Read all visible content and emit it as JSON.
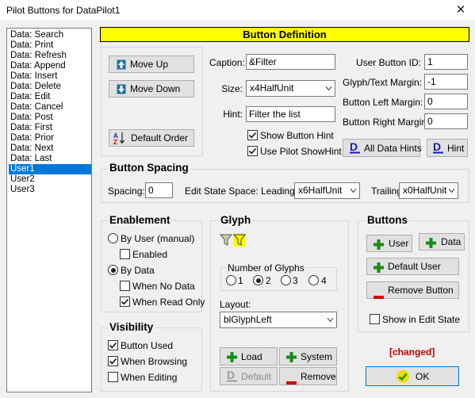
{
  "window": {
    "title": "Pilot Buttons for DataPilot1",
    "close": "✕"
  },
  "buttons_list": {
    "items": [
      "Data: Search",
      "Data: Print",
      "Data: Refresh",
      "Data: Append",
      "Data: Insert",
      "Data: Delete",
      "Data: Edit",
      "Data: Cancel",
      "Data: Post",
      "Data: First",
      "Data: Prior",
      "Data: Next",
      "Data: Last",
      "User1",
      "User2",
      "User3"
    ],
    "selected": "User1"
  },
  "definition": {
    "header": "Button Definition",
    "move_up": "Move Up",
    "move_down": "Move Down",
    "default_order": "Default Order",
    "caption_label": "Caption:",
    "caption_value": "&Filter",
    "size_label": "Size:",
    "size_value": "x4HalfUnit",
    "hint_label": "Hint:",
    "hint_value": "Filter the list",
    "show_button_hint": "Show Button Hint",
    "use_pilot_showhint": "Use Pilot ShowHint",
    "user_button_id_label": "User Button ID:",
    "user_button_id_value": "1",
    "glyph_text_margin_label": "Glyph/Text Margin:",
    "glyph_text_margin_value": "-1",
    "button_left_margin_label": "Button Left Margin:",
    "button_left_margin_value": "0",
    "button_right_margin_label": "Button Right Margin:",
    "button_right_margin_value": "0",
    "all_data_hints": "All Data Hints",
    "hint_button": "Hint"
  },
  "spacing": {
    "title": "Button Spacing",
    "spacing_label": "Spacing:",
    "spacing_value": "0",
    "leading_label": "Edit State Space: Leading =",
    "leading_value": "x6HalfUnit",
    "trailing_label": "Trailing =",
    "trailing_value": "x0HalfUnit"
  },
  "enablement": {
    "title": "Enablement",
    "by_user": "By User (manual)",
    "enabled": "Enabled",
    "by_data": "By Data",
    "when_no_data": "When No Data",
    "when_read_only": "When Read Only"
  },
  "visibility": {
    "title": "Visibility",
    "button_used": "Button Used",
    "when_browsing": "When Browsing",
    "when_editing": "When Editing"
  },
  "glyph": {
    "title": "Glyph",
    "number_of_glyphs": "Number of Glyphs",
    "options": [
      "1",
      "2",
      "3",
      "4"
    ],
    "selected": "2",
    "layout_label": "Layout:",
    "layout_value": "blGlyphLeft",
    "load": "Load",
    "system": "System",
    "default": "Default",
    "remove": "Remove"
  },
  "buttons_group": {
    "title": "Buttons",
    "user": "User",
    "data": "Data",
    "default_user": "Default User",
    "remove_button": "Remove Button",
    "show_in_edit_state": "Show in Edit State"
  },
  "status": {
    "changed": "[changed]"
  },
  "ok": "OK",
  "colors": {
    "accent_yellow": "#ffff00",
    "selection_blue": "#0078d7",
    "plus_green": "#1a8a1a",
    "minus_red": "#d40000",
    "hint_blue": "#1a1ab8",
    "changed_red": "#cc0000"
  }
}
